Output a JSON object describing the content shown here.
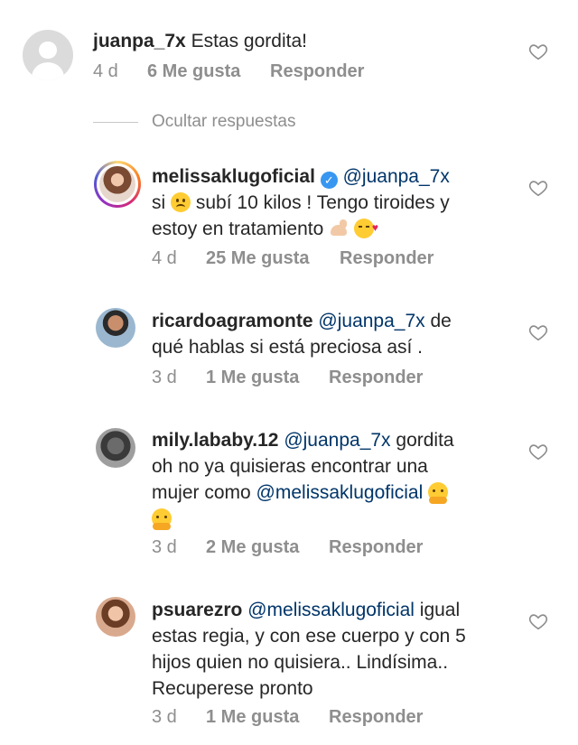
{
  "comments": [
    {
      "username": "juanpa_7x",
      "text": "Estas gordita!",
      "time": "4 d",
      "likes": "6 Me gusta",
      "reply": "Responder"
    },
    {
      "username": "melissaklugoficial",
      "mention": "@juanpa_7x",
      "text_part1": "si",
      "text_part2": "subí 10 kilos ! Tengo tiroides y",
      "text_part3": "estoy en tratamiento",
      "time": "4 d",
      "likes": "25 Me gusta",
      "reply": "Responder",
      "verified": true
    },
    {
      "username": "ricardoagramonte",
      "mention": "@juanpa_7x",
      "text_part1": "de",
      "text_part2": "qué hablas si está preciosa así .",
      "time": "3 d",
      "likes": "1 Me gusta",
      "reply": "Responder"
    },
    {
      "username": "mily.lababy.12",
      "mention": "@juanpa_7x",
      "text_part1": "gordita",
      "text_part2": "oh no ya quisieras encontrar una",
      "text_part3": "mujer como",
      "mention2": "@melissaklugoficial",
      "time": "3 d",
      "likes": "2 Me gusta",
      "reply": "Responder"
    },
    {
      "username": "psuarezro",
      "mention": "@melissaklugoficial",
      "text_part1": "igual",
      "text_part2": "estas regia, y con ese cuerpo y con 5",
      "text_part3": "hijos quien no quisiera.. Lindísima..",
      "text_part4": "Recuperese pronto",
      "time": "3 d",
      "likes": "1 Me gusta",
      "reply": "Responder"
    }
  ],
  "hide_replies": "Ocultar respuestas",
  "colors": {
    "text": "#262626",
    "muted": "#8e8e8e",
    "mention": "#003569",
    "verified": "#3897f0"
  },
  "icons": {
    "like": "heart-outline-icon",
    "verified": "verified-badge-icon"
  }
}
